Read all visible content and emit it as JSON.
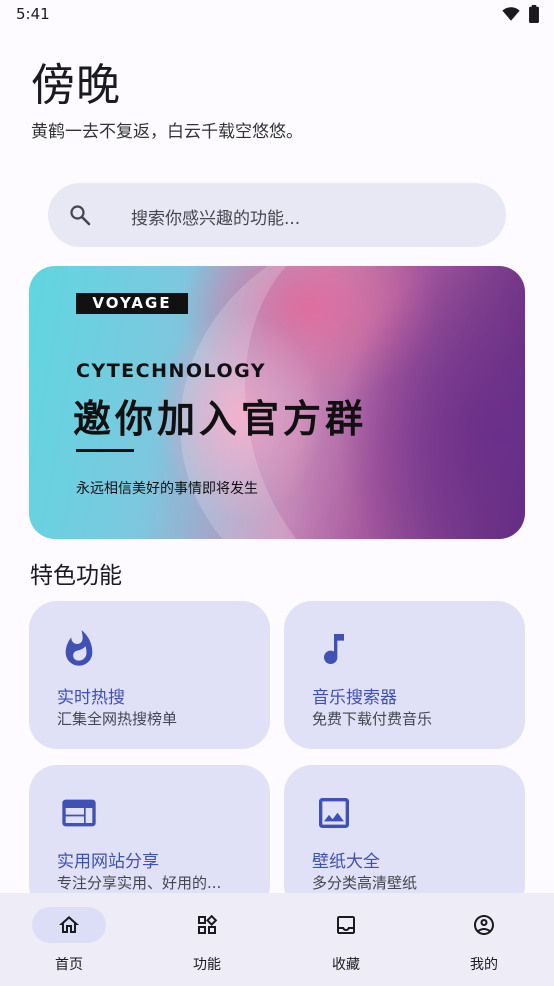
{
  "status_bar": {
    "time": "5:41"
  },
  "header": {
    "title": "傍晚",
    "subtitle": "黄鹤一去不复返，白云千载空悠悠。"
  },
  "search": {
    "placeholder": "搜索你感兴趣的功能..."
  },
  "banner": {
    "tag": "VOYAGE",
    "brand": "CYTECHNOLOGY",
    "headline": "邀你加入官方群",
    "caption": "永远相信美好的事情即将发生"
  },
  "features": {
    "section_title": "特色功能",
    "items": [
      {
        "icon": "fire-icon",
        "title": "实时热搜",
        "desc": "汇集全网热搜榜单"
      },
      {
        "icon": "music-note-icon",
        "title": "音乐搜索器",
        "desc": "免费下载付费音乐"
      },
      {
        "icon": "web-icon",
        "title": "实用网站分享",
        "desc": "专注分享实用、好用的..."
      },
      {
        "icon": "image-icon",
        "title": "壁纸大全",
        "desc": "多分类高清壁纸"
      }
    ]
  },
  "bottom_nav": {
    "items": [
      {
        "label": "首页",
        "icon": "home-icon",
        "active": true
      },
      {
        "label": "功能",
        "icon": "widgets-icon",
        "active": false
      },
      {
        "label": "收藏",
        "icon": "inbox-icon",
        "active": false
      },
      {
        "label": "我的",
        "icon": "account-circle-icon",
        "active": false
      }
    ]
  },
  "colors": {
    "accent": "#3f51b5",
    "card_bg": "#e0e0f7",
    "search_bg": "#e8e8f4",
    "nav_bg": "#eeecf6",
    "nav_active_pill": "#dcdef8"
  }
}
